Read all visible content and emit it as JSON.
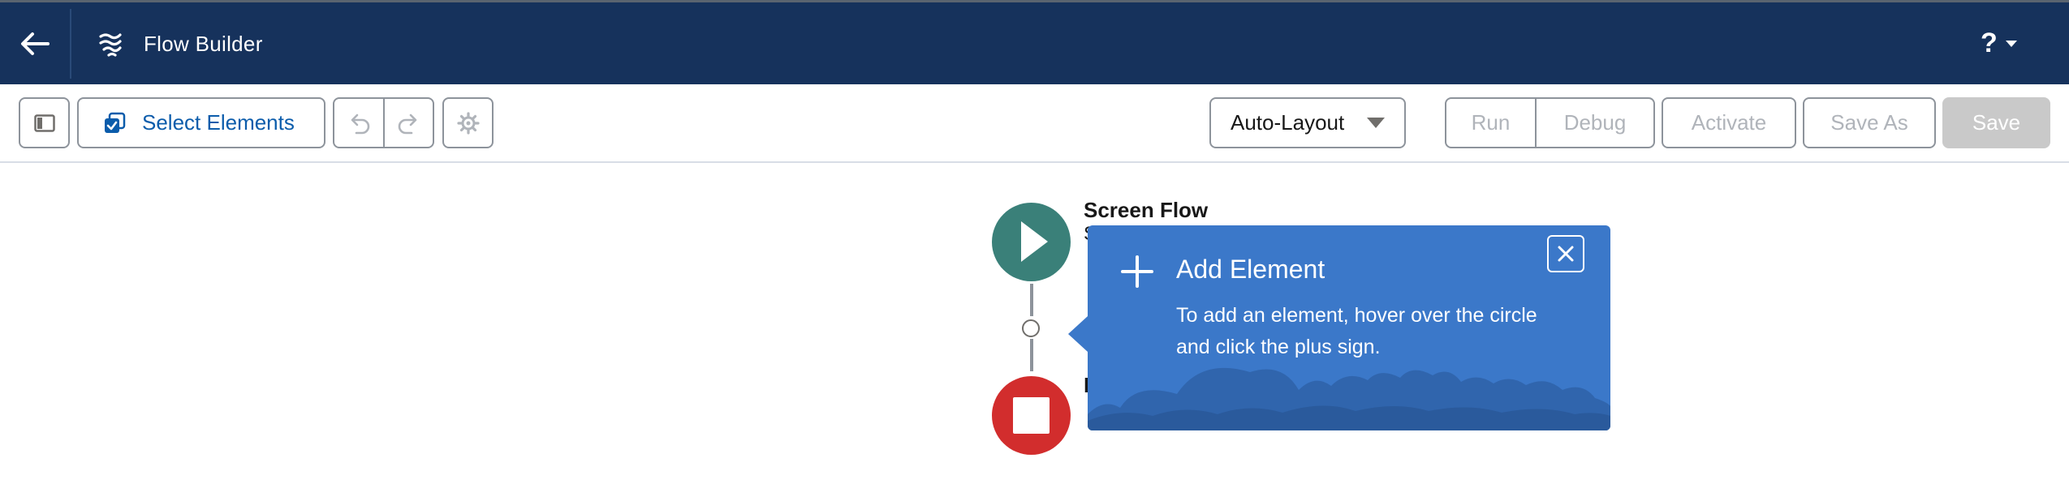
{
  "header": {
    "title": "Flow Builder",
    "help_label": "?"
  },
  "toolbar": {
    "select_elements_label": "Select Elements",
    "layout_label": "Auto-Layout",
    "run_label": "Run",
    "debug_label": "Debug",
    "activate_label": "Activate",
    "save_as_label": "Save As",
    "save_label": "Save"
  },
  "canvas": {
    "start_node_title": "Screen Flow",
    "start_node_subtitle": "S",
    "end_node_label": "E"
  },
  "popover": {
    "title": "Add Element",
    "body": "To add an element, hover over the circle and click the plus sign."
  },
  "colors": {
    "header_bg": "#16325c",
    "brand_blue": "#0b5cab",
    "start_node": "#3a8079",
    "end_node": "#d22d2d",
    "popover_bg": "#3b78c9"
  },
  "icons": [
    "back-arrow-icon",
    "flow-builder-icon",
    "help-icon",
    "toggle-panel-icon",
    "select-elements-icon",
    "undo-icon",
    "redo-icon",
    "gear-icon",
    "chevron-down-icon",
    "play-icon",
    "stop-icon",
    "plus-icon",
    "close-icon"
  ]
}
